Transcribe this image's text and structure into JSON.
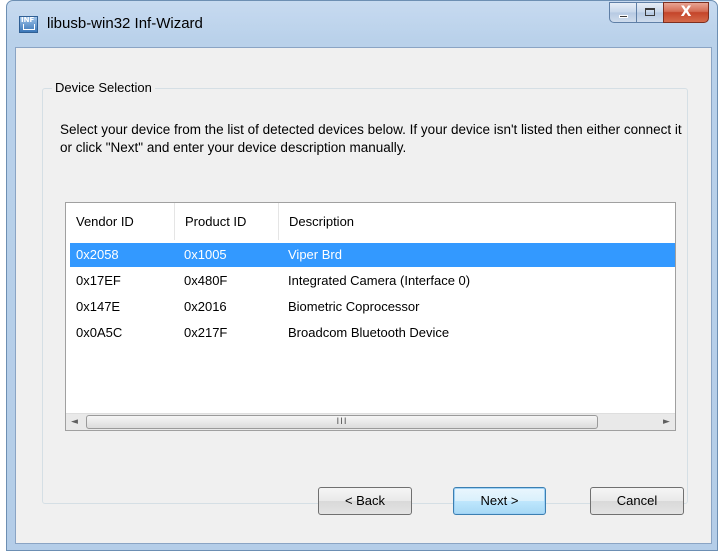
{
  "window": {
    "title": "libusb-win32 Inf-Wizard",
    "icon": "libusb-app-icon",
    "icon_text": "INF",
    "controls": {
      "minimize": "minimize",
      "maximize": "maximize",
      "close_glyph": "X"
    }
  },
  "group": {
    "legend": "Device Selection",
    "instructions": "Select your device from the list of detected devices below. If your device isn't listed then either connect it or click \"Next\" and enter your device description manually."
  },
  "devices": {
    "columns": [
      "Vendor ID",
      "Product ID",
      "Description"
    ],
    "rows": [
      {
        "vendor": "0x2058",
        "product": "0x1005",
        "description": "Viper Brd"
      },
      {
        "vendor": "0x17EF",
        "product": "0x480F",
        "description": "Integrated Camera (Interface 0)"
      },
      {
        "vendor": "0x147E",
        "product": "0x2016",
        "description": "Biometric Coprocessor"
      },
      {
        "vendor": "0x0A5C",
        "product": "0x217F",
        "description": "Broadcom Bluetooth Device"
      }
    ],
    "selected_index": 0,
    "scrollbar": {
      "left_arrow": "◄",
      "right_arrow": "►",
      "grip": "III"
    }
  },
  "buttons": {
    "back": "< Back",
    "next": "Next >",
    "cancel": "Cancel"
  },
  "colors": {
    "selection": "#3399ff",
    "titlebar": "#b9d1ea",
    "close": "#c4442a"
  }
}
